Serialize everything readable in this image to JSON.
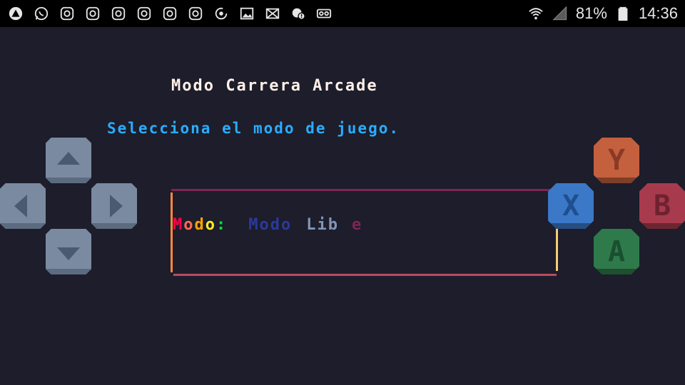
{
  "status_bar": {
    "left_icons": [
      "assistant-icon",
      "whatsapp-icon",
      "instagram-icon",
      "instagram-icon",
      "instagram-icon",
      "instagram-icon",
      "instagram-icon",
      "instagram-icon",
      "sync-icon",
      "image-icon",
      "mail-icon",
      "chat-alert-icon",
      "voicemail-icon"
    ],
    "battery": "81%",
    "time": "14:36"
  },
  "game": {
    "title": "Modo Carrera Arcade",
    "subtitle": "Selecciona el modo de juego.",
    "mode_label": "Modo:",
    "mode_value_parts": [
      "Modo",
      "Lib",
      "e"
    ]
  },
  "controls": {
    "dpad": [
      "up",
      "left",
      "right",
      "down"
    ],
    "buttons": {
      "y": "Y",
      "x": "X",
      "b": "B",
      "a": "A"
    }
  },
  "colors": {
    "background": "#1d1d2b",
    "dpad": "#7a8aa0",
    "y_button": "#c4603d",
    "x_button": "#3b78c7",
    "b_button": "#a83a4d",
    "a_button": "#2e7a4b"
  }
}
